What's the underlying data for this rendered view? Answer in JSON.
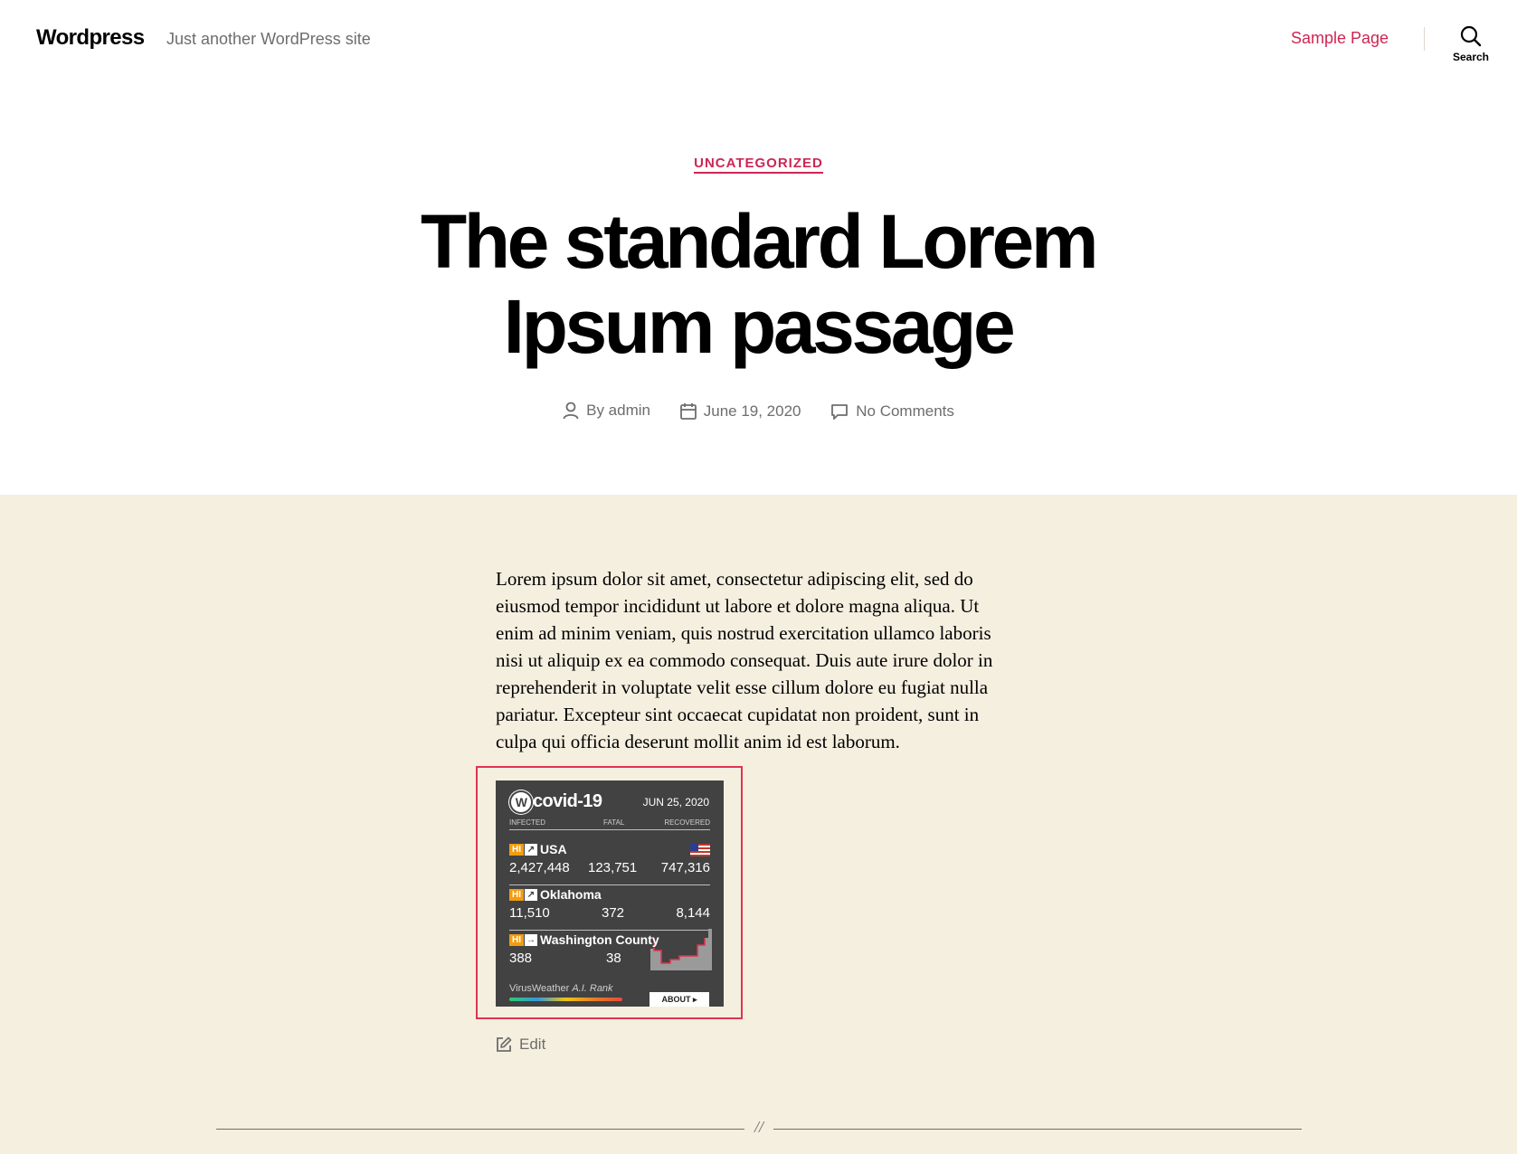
{
  "header": {
    "site_title": "Wordpress",
    "site_description": "Just another WordPress site",
    "nav_items": [
      {
        "label": "Sample Page"
      }
    ],
    "search_label": "Search"
  },
  "entry": {
    "category": "UNCATEGORIZED",
    "title": "The standard Lorem Ipsum passage",
    "meta": {
      "author": "By admin",
      "date": "June 19, 2020",
      "comments": "No Comments"
    },
    "body": "Lorem ipsum dolor sit amet, consectetur adipiscing elit, sed do eiusmod tempor incididunt ut labore et dolore magna aliqua. Ut enim ad minim veniam, quis nostrud exercitation ullamco laboris nisi ut aliquip ex ea commodo consequat. Duis aute irure dolor in reprehenderit in voluptate velit esse cillum dolore eu fugiat nulla pariatur. Excepteur sint occaecat cupidatat non proident, sunt in culpa qui officia deserunt mollit anim id est laborum.",
    "edit_label": "Edit"
  },
  "widget": {
    "logo_badge": "W",
    "logo_text": "covid-19",
    "date": "JUN 25, 2020",
    "headers": {
      "infected": "INFECTED",
      "fatal": "FATAL",
      "recovered": "RECOVERED"
    },
    "hi_label": "HI",
    "rows": [
      {
        "name": "USA",
        "trend": "↗",
        "infected": "2,427,448",
        "fatal": "123,751",
        "recovered": "747,316"
      },
      {
        "name": "Oklahoma",
        "trend": "↗",
        "infected": "11,510",
        "fatal": "372",
        "recovered": "8,144"
      },
      {
        "name": "Washington County",
        "trend": "→",
        "infected": "388",
        "fatal": "38",
        "recovered": ""
      }
    ],
    "footer_brand": "VirusWeather",
    "footer_rank": "A.I. Rank",
    "about_label": "ABOUT ▸"
  },
  "separator": "//",
  "colors": {
    "accent": "#cd2653",
    "content_bg": "#f5efe0",
    "widget_bg": "#424242",
    "widget_frame": "#e0334f",
    "hi_badge": "#f39c12"
  },
  "icons": [
    "search-icon",
    "user-icon",
    "calendar-icon",
    "comment-icon",
    "edit-icon",
    "us-flag-icon"
  ]
}
